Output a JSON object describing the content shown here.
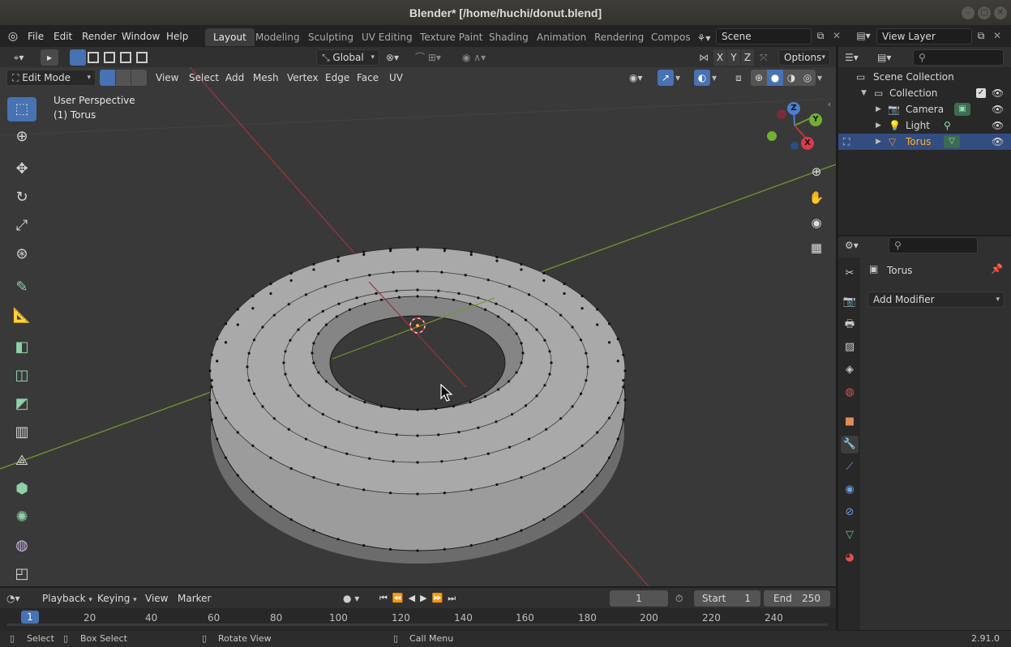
{
  "window": {
    "title": "Blender* [/home/huchi/donut.blend]"
  },
  "menus": [
    "File",
    "Edit",
    "Render",
    "Window",
    "Help"
  ],
  "workspaces": [
    "Layout",
    "Modeling",
    "Sculpting",
    "UV Editing",
    "Texture Paint",
    "Shading",
    "Animation",
    "Rendering",
    "Compos"
  ],
  "active_workspace": "Layout",
  "scene": {
    "name": "Scene"
  },
  "view_layer": {
    "name": "View Layer"
  },
  "toolbar_top": {
    "orientation": "Global",
    "axes": [
      "X",
      "Y",
      "Z"
    ],
    "options_label": "Options"
  },
  "viewport_header": {
    "mode": "Edit Mode",
    "menus": [
      "View",
      "Select",
      "Add",
      "Mesh",
      "Vertex",
      "Edge",
      "Face",
      "UV"
    ]
  },
  "viewport": {
    "perspective": "User Perspective",
    "object_label": "(1) Torus",
    "gizmo": {
      "z": "Z",
      "y": "Y",
      "x": "X"
    }
  },
  "outliner": {
    "root": "Scene Collection",
    "collection": "Collection",
    "items": [
      {
        "name": "Camera",
        "selected": false
      },
      {
        "name": "Light",
        "selected": false
      },
      {
        "name": "Torus",
        "selected": true
      }
    ]
  },
  "properties": {
    "object_name": "Torus",
    "add_modifier_label": "Add Modifier"
  },
  "timeline": {
    "menus": [
      "Playback",
      "Keying",
      "View",
      "Marker"
    ],
    "current_frame": "1",
    "start_label": "Start",
    "start_value": "1",
    "end_label": "End",
    "end_value": "250",
    "ruler": [
      "1",
      "20",
      "40",
      "60",
      "80",
      "100",
      "120",
      "140",
      "160",
      "180",
      "200",
      "220",
      "240"
    ]
  },
  "statusbar": {
    "select": "Select",
    "box_select": "Box Select",
    "rotate_view": "Rotate View",
    "call_menu": "Call Menu",
    "version": "2.91.0"
  },
  "colors": {
    "accent": "#4772b3",
    "x_axis": "#9a3440",
    "y_axis": "#6b9a2f",
    "selected_text": "#ffaf29"
  }
}
